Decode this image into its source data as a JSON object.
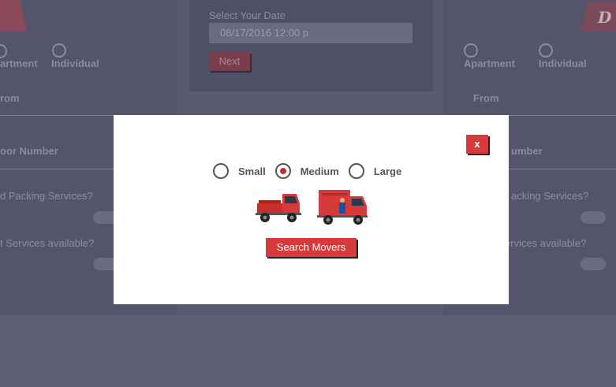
{
  "background": {
    "left_form": {
      "radio_apartment": "artment",
      "radio_individual": "Individual",
      "field_from": "rom",
      "field_floor": "oor Number",
      "q_packing": "d Packing Services?",
      "q_lift": "t Services available?"
    },
    "middle_form": {
      "date_label": "Select Your Date",
      "date_value": "08/17/2016 12:00 p",
      "next_label": "Next"
    },
    "right_form": {
      "radio_apartment": "Apartment",
      "radio_individual": "Individual",
      "field_from": "From",
      "field_floor": "umber",
      "q_packing": "acking Services?",
      "q_lift": "ervices available?",
      "logo_text": "D"
    }
  },
  "modal": {
    "close_label": "x",
    "vehicle_sizes": [
      {
        "label": "Small",
        "checked": false
      },
      {
        "label": "Medium",
        "checked": true
      },
      {
        "label": "Large",
        "checked": false
      }
    ],
    "search_label": "Search Movers"
  },
  "colors": {
    "accent_red": "#d63a3a",
    "overlay": "#5a5a70"
  },
  "icons": [
    "small-truck-icon",
    "large-truck-icon"
  ]
}
